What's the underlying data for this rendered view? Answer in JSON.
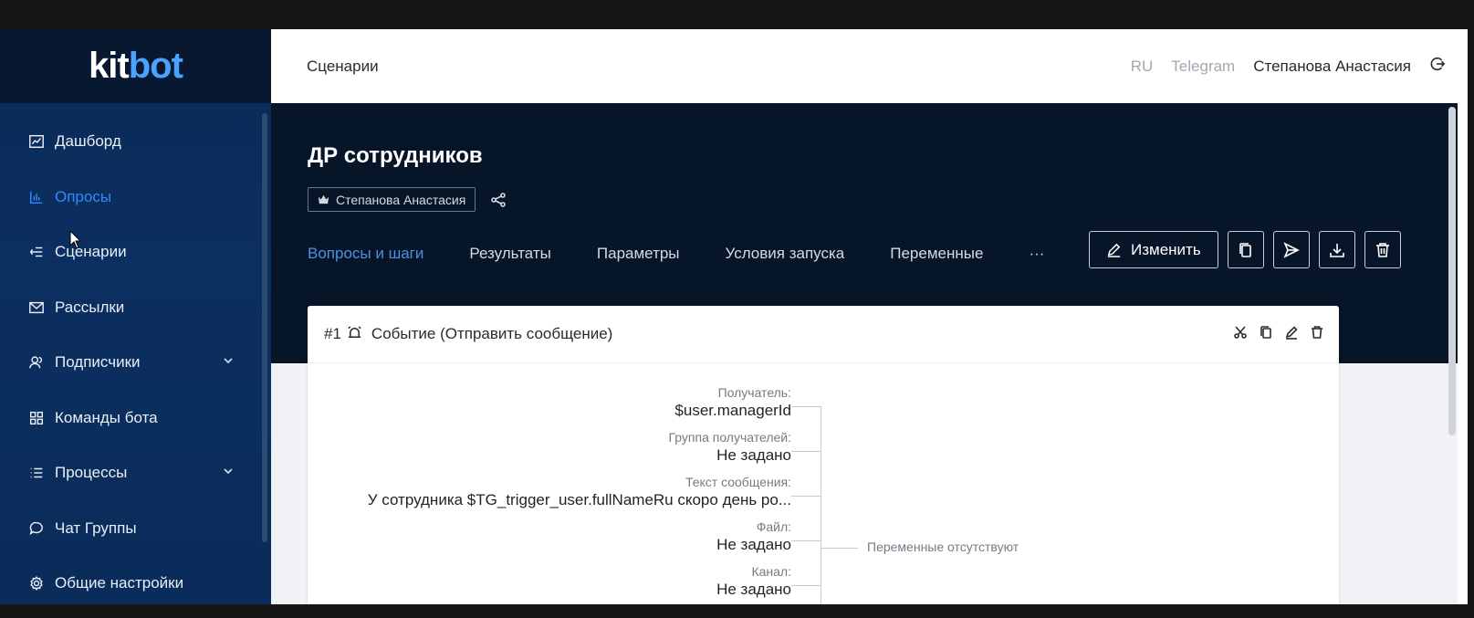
{
  "brand": {
    "logo_text_left": "kit",
    "logo_text_right": "bot"
  },
  "sidebar": {
    "items": [
      {
        "label": "Дашборд",
        "icon": "chart-line-icon",
        "active": false,
        "expandable": false
      },
      {
        "label": "Опросы",
        "icon": "bar-chart-icon",
        "active": true,
        "expandable": false
      },
      {
        "label": "Сценарии",
        "icon": "scenario-icon",
        "active": false,
        "expandable": false
      },
      {
        "label": "Рассылки",
        "icon": "mail-icon",
        "active": false,
        "expandable": false
      },
      {
        "label": "Подписчики",
        "icon": "users-icon",
        "active": false,
        "expandable": true
      },
      {
        "label": "Команды бота",
        "icon": "grid-icon",
        "active": false,
        "expandable": false
      },
      {
        "label": "Процессы",
        "icon": "list-icon",
        "active": false,
        "expandable": true
      },
      {
        "label": "Чат Группы",
        "icon": "chat-icon",
        "active": false,
        "expandable": false
      },
      {
        "label": "Общие настройки",
        "icon": "gear-icon",
        "active": false,
        "expandable": false
      }
    ]
  },
  "topbar": {
    "breadcrumb": "Сценарии",
    "language": "RU",
    "platform": "Telegram",
    "user": "Степанова Анастасия"
  },
  "page": {
    "title": "ДР сотрудников",
    "owner": "Степанова Анастасия",
    "tabs": [
      {
        "label": "Вопросы и шаги",
        "active": true
      },
      {
        "label": "Результаты",
        "active": false
      },
      {
        "label": "Параметры",
        "active": false
      },
      {
        "label": "Условия запуска",
        "active": false
      },
      {
        "label": "Переменные",
        "active": false
      },
      {
        "label": "···",
        "active": false
      }
    ],
    "edit_label": "Изменить"
  },
  "step": {
    "number": "#1",
    "title": "Событие (Отправить сообщение)",
    "params": [
      {
        "label": "Получатель:",
        "value": "$user.managerId"
      },
      {
        "label": "Группа получателей:",
        "value": "Не задано"
      },
      {
        "label": "Текст сообщения:",
        "value": "У сотрудника $TG_trigger_user.fullNameRu скоро день ро..."
      },
      {
        "label": "Файл:",
        "value": "Не задано"
      },
      {
        "label": "Канал:",
        "value": "Не задано"
      }
    ],
    "no_variables": "Переменные отсутствуют"
  },
  "colors": {
    "sidebar_bg": "#0a2a55",
    "accent": "#2f8bff",
    "hero_bg": "#071528"
  }
}
